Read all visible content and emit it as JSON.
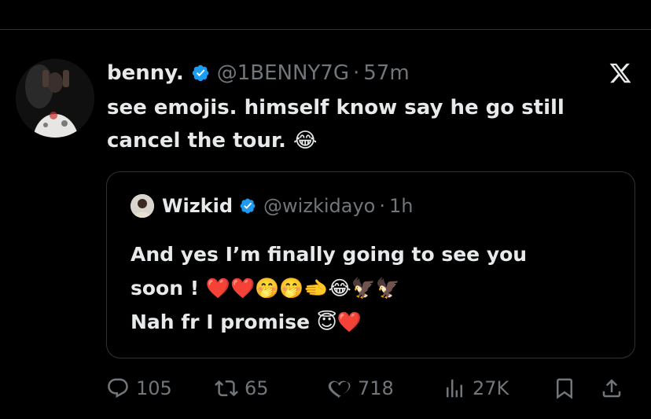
{
  "tweet": {
    "author_name": "benny.",
    "author_handle": "@1BENNY7G",
    "separator": "·",
    "time": "57m",
    "text_line1": "see emojis. himself know say he go still",
    "text_line2": "cancel the tour. 😂"
  },
  "quote": {
    "author_name": "Wizkid",
    "author_handle": "@wizkidayo",
    "separator": "·",
    "time": "1h",
    "line1": "And yes I’m finally going to see you",
    "line2": "soon ! ❤️❤️🤭🤭🫲😂🦅🦅",
    "line3": "Nah fr I promise 😇❤️"
  },
  "actions": {
    "replies": "105",
    "reposts": "65",
    "likes": "718",
    "views": "27K"
  },
  "colors": {
    "background": "#000000",
    "text": "#e7e9ea",
    "muted": "#71767b",
    "border": "#2f3336",
    "verified": "#1d9bf0"
  },
  "icons": [
    "x-logo-icon",
    "verified-badge-icon",
    "reply-icon",
    "repost-icon",
    "like-icon",
    "views-icon",
    "bookmark-icon",
    "share-icon"
  ]
}
